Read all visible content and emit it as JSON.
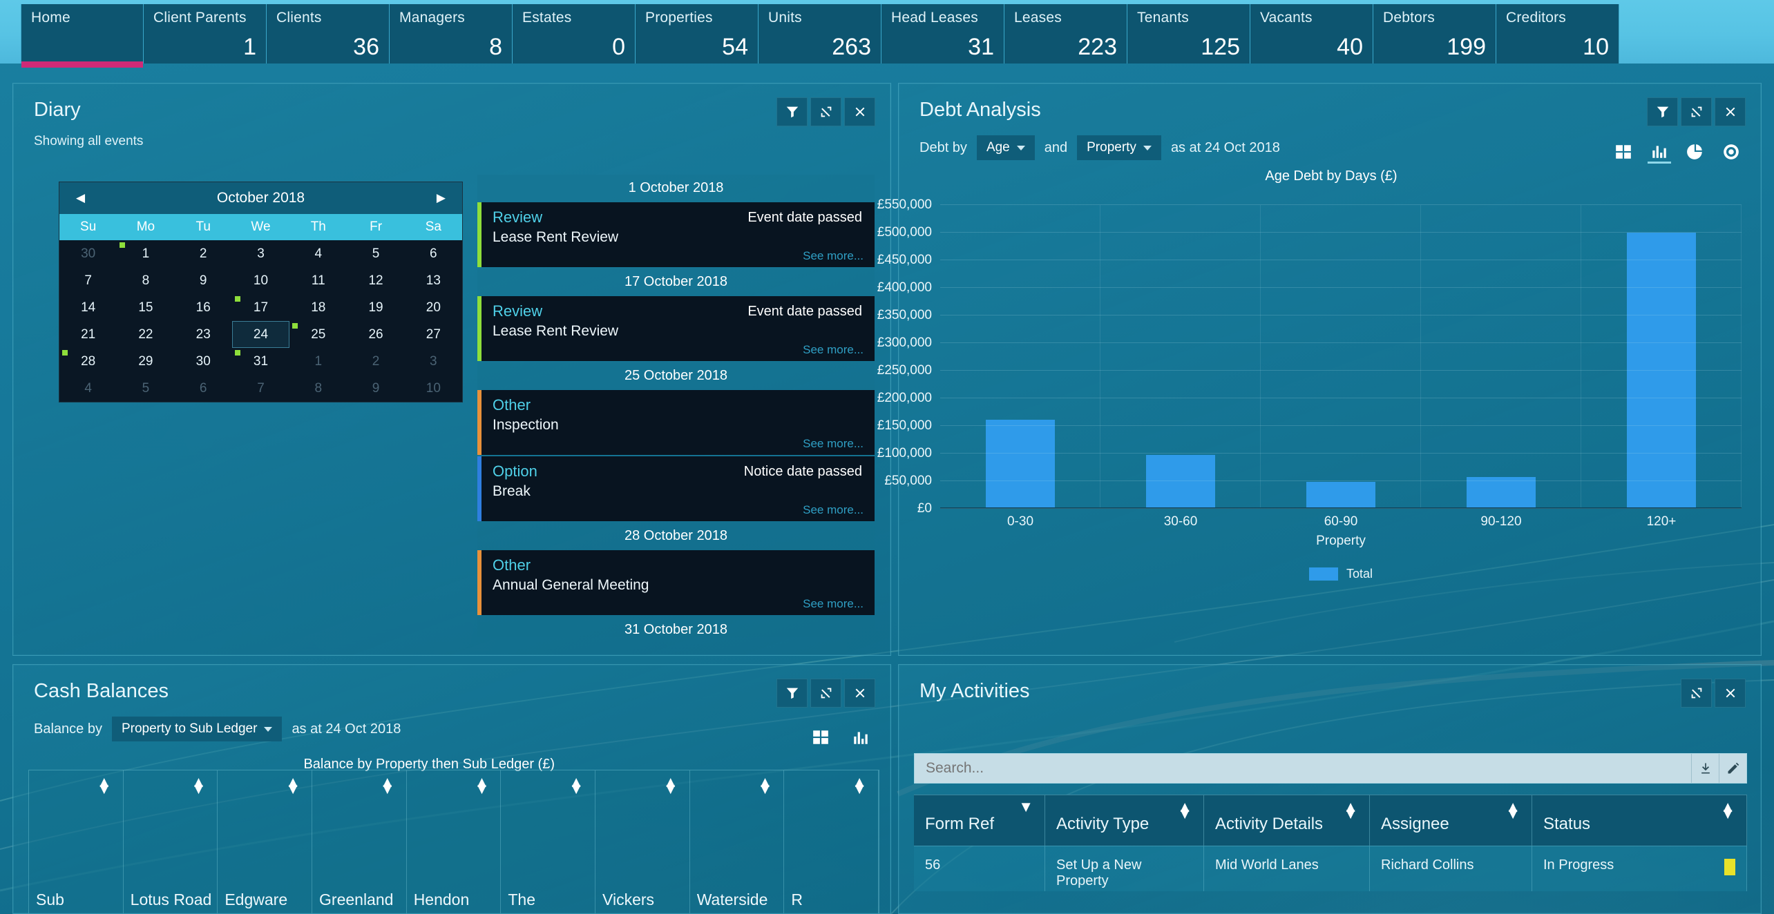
{
  "topbar": {
    "kpis": [
      {
        "label": "Home",
        "value": "",
        "active": true
      },
      {
        "label": "Client Parents",
        "value": "1",
        "active": false
      },
      {
        "label": "Clients",
        "value": "36",
        "active": false
      },
      {
        "label": "Managers",
        "value": "8",
        "active": false
      },
      {
        "label": "Estates",
        "value": "0",
        "active": false
      },
      {
        "label": "Properties",
        "value": "54",
        "active": false
      },
      {
        "label": "Units",
        "value": "263",
        "active": false
      },
      {
        "label": "Head Leases",
        "value": "31",
        "active": false
      },
      {
        "label": "Leases",
        "value": "223",
        "active": false
      },
      {
        "label": "Tenants",
        "value": "125",
        "active": false
      },
      {
        "label": "Vacants",
        "value": "40",
        "active": false
      },
      {
        "label": "Debtors",
        "value": "199",
        "active": false
      },
      {
        "label": "Creditors",
        "value": "10",
        "active": false
      }
    ]
  },
  "diary": {
    "title": "Diary",
    "subline": "Showing all events",
    "calendar": {
      "month_label": "October 2018",
      "prev_icon": "chevron-left-icon",
      "next_icon": "chevron-right-icon",
      "dow": [
        "Su",
        "Mo",
        "Tu",
        "We",
        "Th",
        "Fr",
        "Sa"
      ],
      "weeks": [
        [
          {
            "d": "30",
            "muted": true,
            "dot": false
          },
          {
            "d": "1",
            "muted": false,
            "dot": true
          },
          {
            "d": "2",
            "muted": false,
            "dot": false
          },
          {
            "d": "3",
            "muted": false,
            "dot": false
          },
          {
            "d": "4",
            "muted": false,
            "dot": false
          },
          {
            "d": "5",
            "muted": false,
            "dot": false
          },
          {
            "d": "6",
            "muted": false,
            "dot": false
          }
        ],
        [
          {
            "d": "7",
            "muted": false,
            "dot": false
          },
          {
            "d": "8",
            "muted": false,
            "dot": false
          },
          {
            "d": "9",
            "muted": false,
            "dot": false
          },
          {
            "d": "10",
            "muted": false,
            "dot": false
          },
          {
            "d": "11",
            "muted": false,
            "dot": false
          },
          {
            "d": "12",
            "muted": false,
            "dot": false
          },
          {
            "d": "13",
            "muted": false,
            "dot": false
          }
        ],
        [
          {
            "d": "14",
            "muted": false,
            "dot": false
          },
          {
            "d": "15",
            "muted": false,
            "dot": false
          },
          {
            "d": "16",
            "muted": false,
            "dot": false
          },
          {
            "d": "17",
            "muted": false,
            "dot": true
          },
          {
            "d": "18",
            "muted": false,
            "dot": false
          },
          {
            "d": "19",
            "muted": false,
            "dot": false
          },
          {
            "d": "20",
            "muted": false,
            "dot": false
          }
        ],
        [
          {
            "d": "21",
            "muted": false,
            "dot": false
          },
          {
            "d": "22",
            "muted": false,
            "dot": false
          },
          {
            "d": "23",
            "muted": false,
            "dot": false
          },
          {
            "d": "24",
            "muted": false,
            "dot": false,
            "selected": true
          },
          {
            "d": "25",
            "muted": false,
            "dot": true
          },
          {
            "d": "26",
            "muted": false,
            "dot": false
          },
          {
            "d": "27",
            "muted": false,
            "dot": false
          }
        ],
        [
          {
            "d": "28",
            "muted": false,
            "dot": true
          },
          {
            "d": "29",
            "muted": false,
            "dot": false
          },
          {
            "d": "30",
            "muted": false,
            "dot": false
          },
          {
            "d": "31",
            "muted": false,
            "dot": true
          },
          {
            "d": "1",
            "muted": true,
            "dot": false
          },
          {
            "d": "2",
            "muted": true,
            "dot": false
          },
          {
            "d": "3",
            "muted": true,
            "dot": false
          }
        ],
        [
          {
            "d": "4",
            "muted": true,
            "dot": false
          },
          {
            "d": "5",
            "muted": true,
            "dot": false
          },
          {
            "d": "6",
            "muted": true,
            "dot": false
          },
          {
            "d": "7",
            "muted": true,
            "dot": false
          },
          {
            "d": "8",
            "muted": true,
            "dot": false
          },
          {
            "d": "9",
            "muted": true,
            "dot": false
          },
          {
            "d": "10",
            "muted": true,
            "dot": false
          }
        ]
      ]
    },
    "events": [
      {
        "kind": "date",
        "label": "1 October 2018"
      },
      {
        "kind": "event",
        "type": "Review",
        "desc": "Lease Rent Review",
        "status": "Event date passed",
        "more": "See more...",
        "accent": "green"
      },
      {
        "kind": "date",
        "label": "17 October 2018"
      },
      {
        "kind": "event",
        "type": "Review",
        "desc": "Lease Rent Review",
        "status": "Event date passed",
        "more": "See more...",
        "accent": "green"
      },
      {
        "kind": "date",
        "label": "25 October 2018"
      },
      {
        "kind": "event",
        "type": "Other",
        "desc": "Inspection",
        "status": "",
        "more": "See more...",
        "accent": "orange"
      },
      {
        "kind": "event",
        "type": "Option",
        "desc": "Break",
        "status": "Notice date passed",
        "more": "See more...",
        "accent": "blue"
      },
      {
        "kind": "date",
        "label": "28 October 2018"
      },
      {
        "kind": "event",
        "type": "Other",
        "desc": "Annual General Meeting",
        "status": "",
        "more": "See more...",
        "accent": "orange"
      },
      {
        "kind": "date",
        "label": "31 October 2018"
      }
    ],
    "tools": [
      "filter-icon",
      "expand-icon",
      "close-icon"
    ]
  },
  "debt": {
    "title": "Debt Analysis",
    "controls": {
      "prefix": "Debt by",
      "dim1": "Age",
      "conjunction": "and",
      "dim2": "Property",
      "asat": "as at 24 Oct 2018"
    },
    "tools": [
      "filter-icon",
      "expand-icon",
      "close-icon"
    ],
    "view_icons": [
      "grid-view-icon",
      "bar-chart-icon",
      "pie-chart-icon",
      "donut-chart-icon"
    ],
    "view_active_index": 1,
    "chart_data": {
      "type": "bar",
      "title": "Age Debt by Days (£)",
      "categories": [
        "0-30",
        "30-60",
        "60-90",
        "90-120",
        "120+"
      ],
      "values": [
        160000,
        95000,
        47000,
        55000,
        500000
      ],
      "series": [
        {
          "name": "Total",
          "values": [
            160000,
            95000,
            47000,
            55000,
            500000
          ]
        }
      ],
      "xlabel": "Property",
      "ylabel": "",
      "ylim": [
        0,
        550000
      ],
      "yticks": [
        "£0",
        "£50,000",
        "£100,000",
        "£150,000",
        "£200,000",
        "£250,000",
        "£300,000",
        "£350,000",
        "£400,000",
        "£450,000",
        "£500,000",
        "£550,000"
      ],
      "legend": [
        "Total"
      ],
      "legend_position": "bottom",
      "grid": true,
      "bar_color": "#2f9bea"
    }
  },
  "cash": {
    "title": "Cash Balances",
    "controls": {
      "prefix": "Balance by",
      "dim": "Property to Sub Ledger",
      "asat": "as at 24 Oct 2018"
    },
    "chart_title": "Balance by Property then Sub Ledger (£)",
    "tools": [
      "filter-icon",
      "expand-icon",
      "close-icon"
    ],
    "view_icons": [
      "grid-view-icon",
      "bar-chart-icon"
    ],
    "columns": [
      "Sub",
      "Lotus Road",
      "Edgware",
      "Greenland",
      "Hendon",
      "The",
      "Vickers",
      "Waterside",
      "R"
    ],
    "sort_icon": "sort-updown-icon"
  },
  "activities": {
    "title": "My Activities",
    "tools": [
      "expand-icon",
      "close-icon"
    ],
    "search": {
      "value": "",
      "placeholder": "Search...",
      "buttons": [
        "download-icon",
        "edit-icon"
      ]
    },
    "columns": [
      "Form Ref",
      "Activity Type",
      "Activity Details",
      "Assignee",
      "Status"
    ],
    "column_sort_icons": [
      "caret-down-icon",
      "sort-updown-icon",
      "sort-updown-icon",
      "sort-updown-icon",
      "sort-updown-icon"
    ],
    "rows": [
      {
        "form_ref": "56",
        "activity_type": "Set Up a New Property",
        "activity_details": "Mid World Lanes",
        "assignee": "Richard Collins",
        "status": "In Progress",
        "status_color": "#e8e22a"
      }
    ]
  }
}
